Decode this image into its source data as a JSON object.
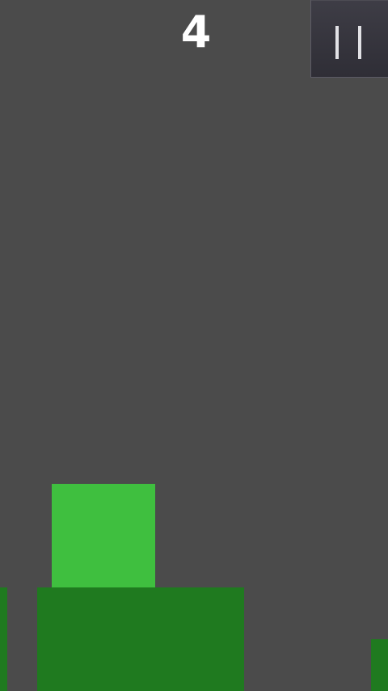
{
  "hud": {
    "score": "4",
    "pause_icon": "pause-icon"
  },
  "colors": {
    "background": "#4b4b4b",
    "player_block": "#3fbf3f",
    "platform": "#1f7a1f",
    "pause_button_bg": "#35343c",
    "text": "#ffffff"
  }
}
